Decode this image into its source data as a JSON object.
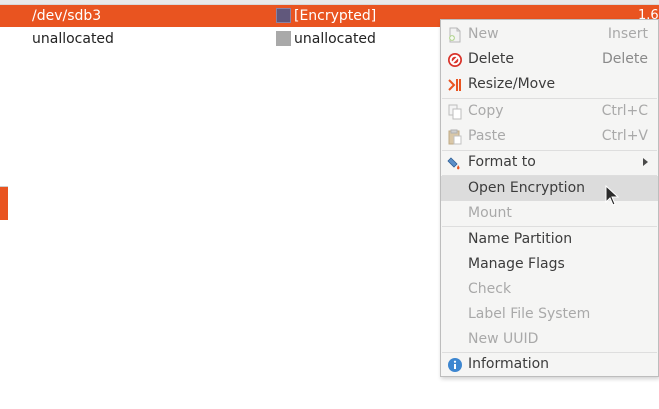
{
  "table": {
    "rows": [
      {
        "partition": "/dev/sdb3",
        "filesystem": "[Encrypted]",
        "size": "1.6",
        "swatch_color": "#61587c"
      },
      {
        "partition": "unallocated",
        "filesystem": "unallocated",
        "size": "",
        "swatch_color": "#a9a9a9"
      }
    ]
  },
  "context_menu": {
    "items": [
      {
        "label": "New",
        "accel": "Insert",
        "enabled": false,
        "icon": "new-icon"
      },
      {
        "label": "Delete",
        "accel": "Delete",
        "enabled": true,
        "icon": "delete-icon"
      },
      {
        "label": "Resize/Move",
        "accel": "",
        "enabled": true,
        "icon": "resize-icon"
      },
      {
        "label": "Copy",
        "accel": "Ctrl+C",
        "enabled": false,
        "icon": "copy-icon"
      },
      {
        "label": "Paste",
        "accel": "Ctrl+V",
        "enabled": false,
        "icon": "paste-icon"
      },
      {
        "label": "Format to",
        "accel": "",
        "enabled": true,
        "icon": "format-icon",
        "submenu": true
      },
      {
        "label": "Open Encryption",
        "accel": "",
        "enabled": true,
        "hovered": true
      },
      {
        "label": "Mount",
        "accel": "",
        "enabled": false
      },
      {
        "label": "Name Partition",
        "accel": "",
        "enabled": true
      },
      {
        "label": "Manage Flags",
        "accel": "",
        "enabled": true
      },
      {
        "label": "Check",
        "accel": "",
        "enabled": false
      },
      {
        "label": "Label File System",
        "accel": "",
        "enabled": false
      },
      {
        "label": "New UUID",
        "accel": "",
        "enabled": false
      },
      {
        "label": "Information",
        "accel": "",
        "enabled": true,
        "icon": "information-icon"
      }
    ]
  },
  "colors": {
    "selection": "#e95420",
    "menu_bg": "#f5f5f4",
    "hover_bg": "#dcdcdc",
    "disabled_text": "#a9a9a9"
  }
}
